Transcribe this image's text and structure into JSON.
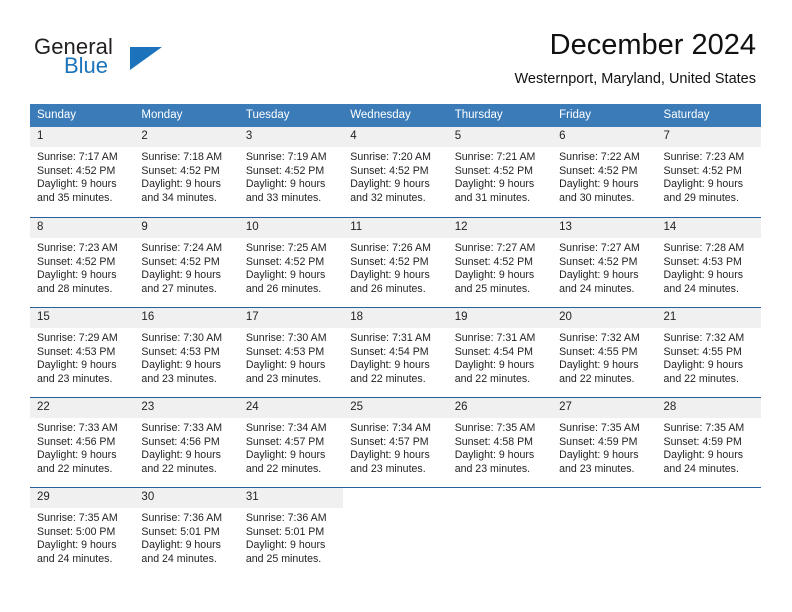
{
  "brand": {
    "name_part1": "General",
    "name_part2": "Blue",
    "logo_icon": "blue-triangle-icon",
    "accent_color": "#1b74bb"
  },
  "header": {
    "month_title": "December 2024",
    "location": "Westernport, Maryland, United States"
  },
  "calendar": {
    "header_bg": "#3b7cb8",
    "daynum_bg": "#f0f0f0",
    "rule_color": "#2a6099",
    "weekday_headers": [
      "Sunday",
      "Monday",
      "Tuesday",
      "Wednesday",
      "Thursday",
      "Friday",
      "Saturday"
    ],
    "weeks": [
      [
        {
          "day": "1",
          "sunrise": "Sunrise: 7:17 AM",
          "sunset": "Sunset: 4:52 PM",
          "daylight_line1": "Daylight: 9 hours",
          "daylight_line2": "and 35 minutes."
        },
        {
          "day": "2",
          "sunrise": "Sunrise: 7:18 AM",
          "sunset": "Sunset: 4:52 PM",
          "daylight_line1": "Daylight: 9 hours",
          "daylight_line2": "and 34 minutes."
        },
        {
          "day": "3",
          "sunrise": "Sunrise: 7:19 AM",
          "sunset": "Sunset: 4:52 PM",
          "daylight_line1": "Daylight: 9 hours",
          "daylight_line2": "and 33 minutes."
        },
        {
          "day": "4",
          "sunrise": "Sunrise: 7:20 AM",
          "sunset": "Sunset: 4:52 PM",
          "daylight_line1": "Daylight: 9 hours",
          "daylight_line2": "and 32 minutes."
        },
        {
          "day": "5",
          "sunrise": "Sunrise: 7:21 AM",
          "sunset": "Sunset: 4:52 PM",
          "daylight_line1": "Daylight: 9 hours",
          "daylight_line2": "and 31 minutes."
        },
        {
          "day": "6",
          "sunrise": "Sunrise: 7:22 AM",
          "sunset": "Sunset: 4:52 PM",
          "daylight_line1": "Daylight: 9 hours",
          "daylight_line2": "and 30 minutes."
        },
        {
          "day": "7",
          "sunrise": "Sunrise: 7:23 AM",
          "sunset": "Sunset: 4:52 PM",
          "daylight_line1": "Daylight: 9 hours",
          "daylight_line2": "and 29 minutes."
        }
      ],
      [
        {
          "day": "8",
          "sunrise": "Sunrise: 7:23 AM",
          "sunset": "Sunset: 4:52 PM",
          "daylight_line1": "Daylight: 9 hours",
          "daylight_line2": "and 28 minutes."
        },
        {
          "day": "9",
          "sunrise": "Sunrise: 7:24 AM",
          "sunset": "Sunset: 4:52 PM",
          "daylight_line1": "Daylight: 9 hours",
          "daylight_line2": "and 27 minutes."
        },
        {
          "day": "10",
          "sunrise": "Sunrise: 7:25 AM",
          "sunset": "Sunset: 4:52 PM",
          "daylight_line1": "Daylight: 9 hours",
          "daylight_line2": "and 26 minutes."
        },
        {
          "day": "11",
          "sunrise": "Sunrise: 7:26 AM",
          "sunset": "Sunset: 4:52 PM",
          "daylight_line1": "Daylight: 9 hours",
          "daylight_line2": "and 26 minutes."
        },
        {
          "day": "12",
          "sunrise": "Sunrise: 7:27 AM",
          "sunset": "Sunset: 4:52 PM",
          "daylight_line1": "Daylight: 9 hours",
          "daylight_line2": "and 25 minutes."
        },
        {
          "day": "13",
          "sunrise": "Sunrise: 7:27 AM",
          "sunset": "Sunset: 4:52 PM",
          "daylight_line1": "Daylight: 9 hours",
          "daylight_line2": "and 24 minutes."
        },
        {
          "day": "14",
          "sunrise": "Sunrise: 7:28 AM",
          "sunset": "Sunset: 4:53 PM",
          "daylight_line1": "Daylight: 9 hours",
          "daylight_line2": "and 24 minutes."
        }
      ],
      [
        {
          "day": "15",
          "sunrise": "Sunrise: 7:29 AM",
          "sunset": "Sunset: 4:53 PM",
          "daylight_line1": "Daylight: 9 hours",
          "daylight_line2": "and 23 minutes."
        },
        {
          "day": "16",
          "sunrise": "Sunrise: 7:30 AM",
          "sunset": "Sunset: 4:53 PM",
          "daylight_line1": "Daylight: 9 hours",
          "daylight_line2": "and 23 minutes."
        },
        {
          "day": "17",
          "sunrise": "Sunrise: 7:30 AM",
          "sunset": "Sunset: 4:53 PM",
          "daylight_line1": "Daylight: 9 hours",
          "daylight_line2": "and 23 minutes."
        },
        {
          "day": "18",
          "sunrise": "Sunrise: 7:31 AM",
          "sunset": "Sunset: 4:54 PM",
          "daylight_line1": "Daylight: 9 hours",
          "daylight_line2": "and 22 minutes."
        },
        {
          "day": "19",
          "sunrise": "Sunrise: 7:31 AM",
          "sunset": "Sunset: 4:54 PM",
          "daylight_line1": "Daylight: 9 hours",
          "daylight_line2": "and 22 minutes."
        },
        {
          "day": "20",
          "sunrise": "Sunrise: 7:32 AM",
          "sunset": "Sunset: 4:55 PM",
          "daylight_line1": "Daylight: 9 hours",
          "daylight_line2": "and 22 minutes."
        },
        {
          "day": "21",
          "sunrise": "Sunrise: 7:32 AM",
          "sunset": "Sunset: 4:55 PM",
          "daylight_line1": "Daylight: 9 hours",
          "daylight_line2": "and 22 minutes."
        }
      ],
      [
        {
          "day": "22",
          "sunrise": "Sunrise: 7:33 AM",
          "sunset": "Sunset: 4:56 PM",
          "daylight_line1": "Daylight: 9 hours",
          "daylight_line2": "and 22 minutes."
        },
        {
          "day": "23",
          "sunrise": "Sunrise: 7:33 AM",
          "sunset": "Sunset: 4:56 PM",
          "daylight_line1": "Daylight: 9 hours",
          "daylight_line2": "and 22 minutes."
        },
        {
          "day": "24",
          "sunrise": "Sunrise: 7:34 AM",
          "sunset": "Sunset: 4:57 PM",
          "daylight_line1": "Daylight: 9 hours",
          "daylight_line2": "and 22 minutes."
        },
        {
          "day": "25",
          "sunrise": "Sunrise: 7:34 AM",
          "sunset": "Sunset: 4:57 PM",
          "daylight_line1": "Daylight: 9 hours",
          "daylight_line2": "and 23 minutes."
        },
        {
          "day": "26",
          "sunrise": "Sunrise: 7:35 AM",
          "sunset": "Sunset: 4:58 PM",
          "daylight_line1": "Daylight: 9 hours",
          "daylight_line2": "and 23 minutes."
        },
        {
          "day": "27",
          "sunrise": "Sunrise: 7:35 AM",
          "sunset": "Sunset: 4:59 PM",
          "daylight_line1": "Daylight: 9 hours",
          "daylight_line2": "and 23 minutes."
        },
        {
          "day": "28",
          "sunrise": "Sunrise: 7:35 AM",
          "sunset": "Sunset: 4:59 PM",
          "daylight_line1": "Daylight: 9 hours",
          "daylight_line2": "and 24 minutes."
        }
      ],
      [
        {
          "day": "29",
          "sunrise": "Sunrise: 7:35 AM",
          "sunset": "Sunset: 5:00 PM",
          "daylight_line1": "Daylight: 9 hours",
          "daylight_line2": "and 24 minutes."
        },
        {
          "day": "30",
          "sunrise": "Sunrise: 7:36 AM",
          "sunset": "Sunset: 5:01 PM",
          "daylight_line1": "Daylight: 9 hours",
          "daylight_line2": "and 24 minutes."
        },
        {
          "day": "31",
          "sunrise": "Sunrise: 7:36 AM",
          "sunset": "Sunset: 5:01 PM",
          "daylight_line1": "Daylight: 9 hours",
          "daylight_line2": "and 25 minutes."
        },
        {
          "day": "",
          "sunrise": "",
          "sunset": "",
          "daylight_line1": "",
          "daylight_line2": ""
        },
        {
          "day": "",
          "sunrise": "",
          "sunset": "",
          "daylight_line1": "",
          "daylight_line2": ""
        },
        {
          "day": "",
          "sunrise": "",
          "sunset": "",
          "daylight_line1": "",
          "daylight_line2": ""
        },
        {
          "day": "",
          "sunrise": "",
          "sunset": "",
          "daylight_line1": "",
          "daylight_line2": ""
        }
      ]
    ]
  }
}
